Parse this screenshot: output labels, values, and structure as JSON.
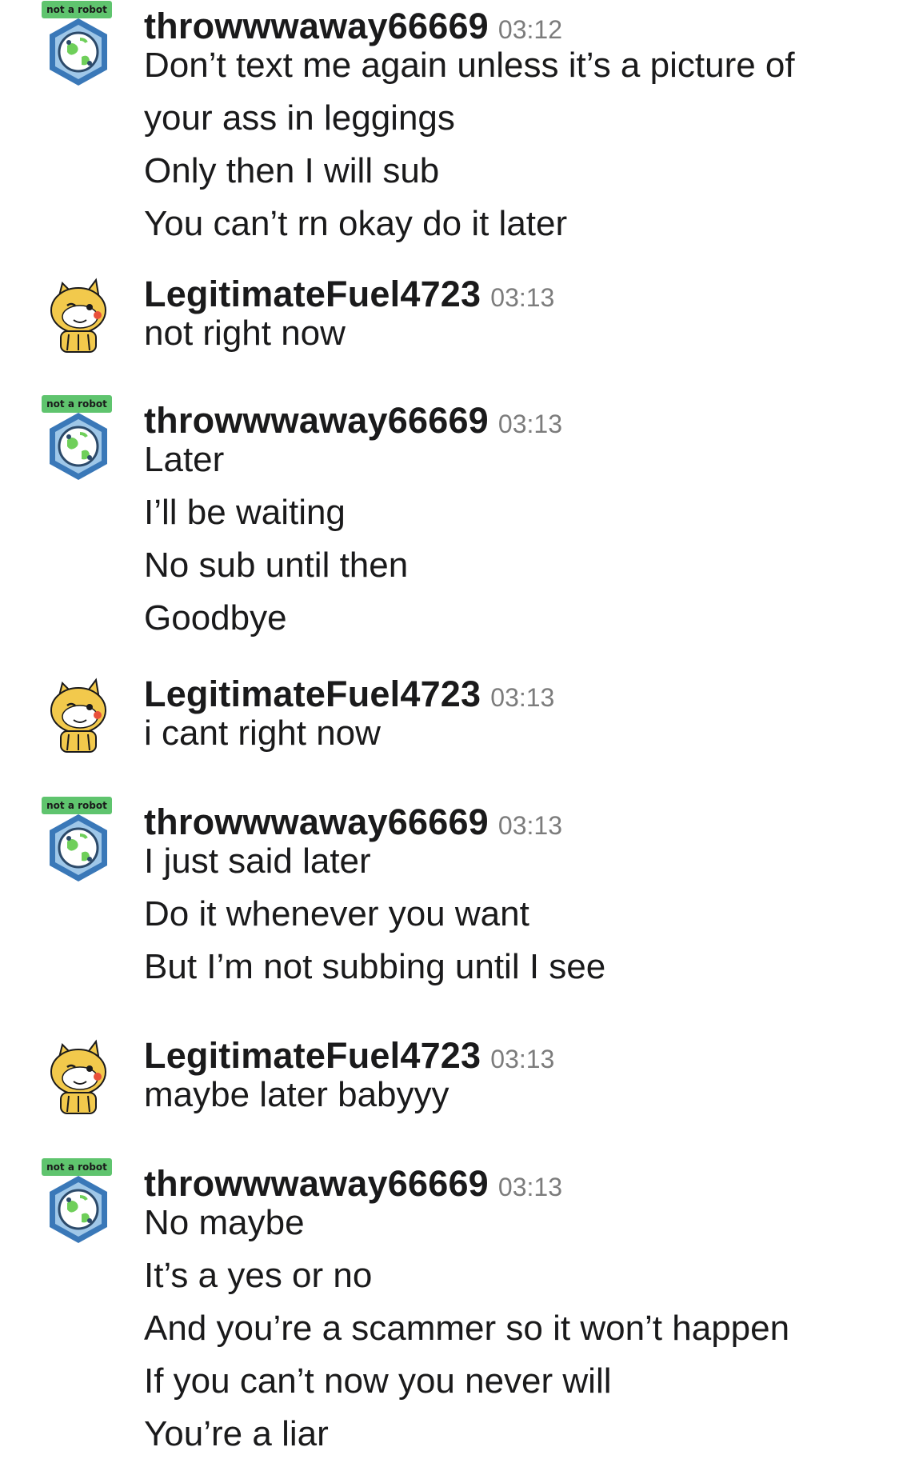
{
  "badge_text": "not a robot",
  "colors": {
    "badge": "#5fc46e",
    "bot_hex_blue": "#3a78b8",
    "bot_hex_inner": "#9fc7e8",
    "bot_globe": "#6fcf5a",
    "snoo_gold": "#f2c94c",
    "text": "#1a1a1b",
    "timestamp": "#7c7c7c"
  },
  "messages": [
    {
      "user": "throwwwaway66669",
      "time": "03:12",
      "avatar": "robot-globe-avatar",
      "lines": [
        "Don’t text me again unless it’s a picture of",
        "your ass in leggings",
        "Only then I will sub",
        "You can’t rn okay do it later"
      ]
    },
    {
      "user": "LegitimateFuel4723",
      "time": "03:13",
      "avatar": "shiba-snoo-avatar",
      "lines": [
        "not right now"
      ]
    },
    {
      "user": "throwwwaway66669",
      "time": "03:13",
      "avatar": "robot-globe-avatar",
      "lines": [
        "Later",
        "I’ll be waiting",
        "No sub until then",
        "Goodbye"
      ]
    },
    {
      "user": "LegitimateFuel4723",
      "time": "03:13",
      "avatar": "shiba-snoo-avatar",
      "lines": [
        "i cant right now"
      ]
    },
    {
      "user": "throwwwaway66669",
      "time": "03:13",
      "avatar": "robot-globe-avatar",
      "lines": [
        "I just said later",
        "Do it whenever you want",
        "But I’m not subbing until I see"
      ]
    },
    {
      "user": "LegitimateFuel4723",
      "time": "03:13",
      "avatar": "shiba-snoo-avatar",
      "lines": [
        "maybe later babyyy"
      ]
    },
    {
      "user": "throwwwaway66669",
      "time": "03:13",
      "avatar": "robot-globe-avatar",
      "lines": [
        "No maybe",
        "It’s a yes or no",
        "And you’re a scammer so it won’t happen",
        "If you can’t now you never will",
        "You’re a liar"
      ]
    }
  ]
}
